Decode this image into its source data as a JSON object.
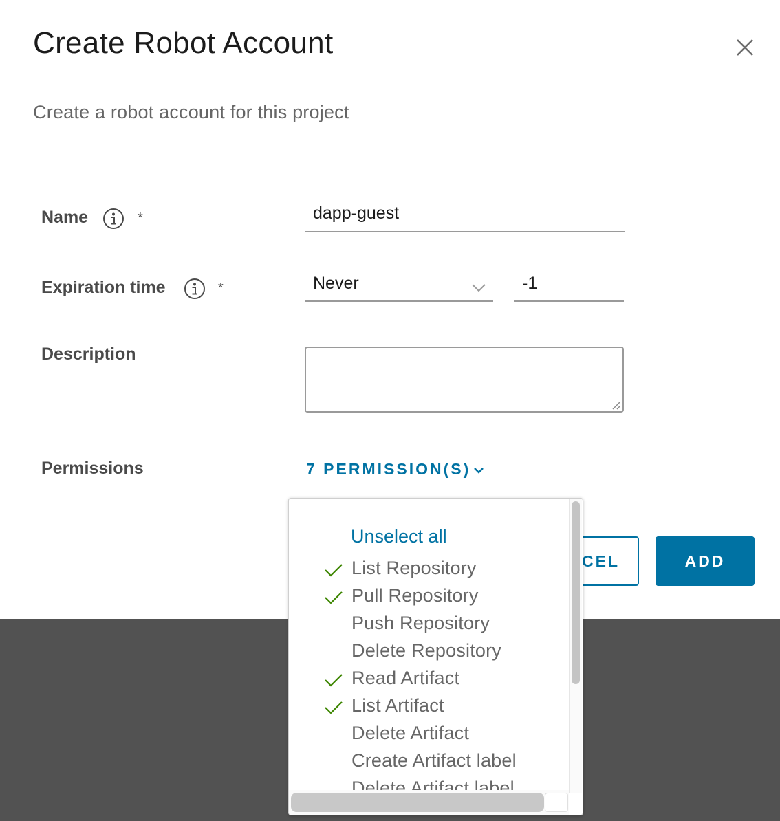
{
  "dialog": {
    "title": "Create Robot Account",
    "subtitle": "Create a robot account for this project",
    "close_icon": "close-icon"
  },
  "form": {
    "name": {
      "label": "Name",
      "required_marker": "*",
      "value": "dapp-guest"
    },
    "expiration": {
      "label": "Expiration time",
      "required_marker": "*",
      "select_value": "Never",
      "days_value": "-1"
    },
    "description": {
      "label": "Description",
      "value": ""
    },
    "permissions": {
      "label": "Permissions",
      "toggle_label": "7 PERMISSION(S)"
    }
  },
  "buttons": {
    "cancel_label": "CEL",
    "add_label": "ADD"
  },
  "permissions_menu": {
    "unselect_all": "Unselect all",
    "options": [
      {
        "label": "List Repository",
        "checked": true
      },
      {
        "label": "Pull Repository",
        "checked": true
      },
      {
        "label": "Push Repository",
        "checked": false
      },
      {
        "label": "Delete Repository",
        "checked": false
      },
      {
        "label": "Read Artifact",
        "checked": true
      },
      {
        "label": "List Artifact",
        "checked": true
      },
      {
        "label": "Delete Artifact",
        "checked": false
      },
      {
        "label": "Create Artifact label",
        "checked": false
      },
      {
        "label": "Delete Artifact label",
        "checked": false
      }
    ]
  },
  "colors": {
    "accent": "#0072a3",
    "check": "#3c8500",
    "overlay": "#525252"
  }
}
